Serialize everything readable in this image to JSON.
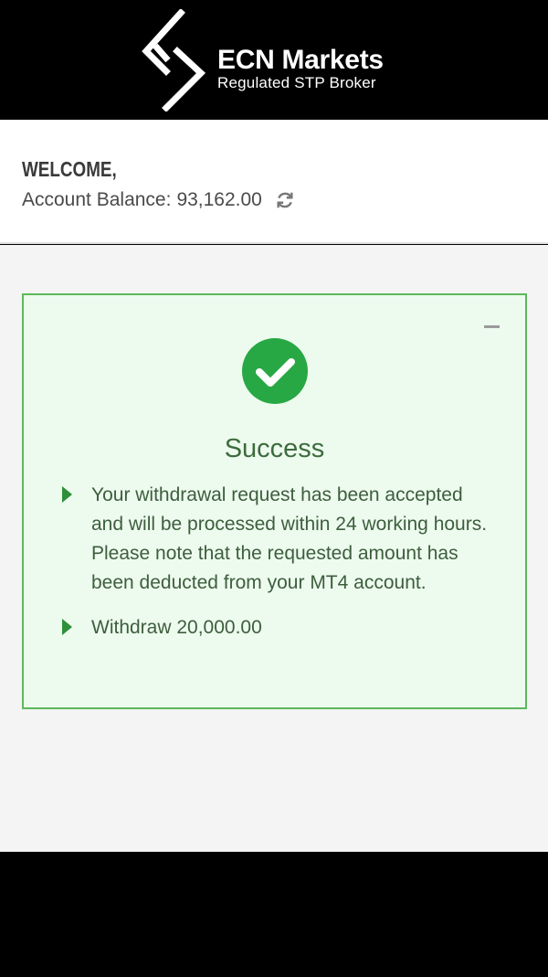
{
  "header": {
    "brand_name": "ECN Markets",
    "tagline": "Regulated STP Broker",
    "logo_icon": "chevron-s-logo-icon"
  },
  "account": {
    "welcome": "WELCOME,",
    "balance_label": "Account Balance:",
    "balance_value": "93,162.00",
    "refresh_icon": "refresh-icon"
  },
  "alert": {
    "status_icon": "check-circle-icon",
    "collapse_icon": "minus-icon",
    "title": "Success",
    "messages": [
      "Your withdrawal request has been accepted and will be processed within 24 working hours. Please note that the requested amount has been deducted from your MT4 account.",
      "Withdraw 20,000.00"
    ]
  },
  "colors": {
    "success_green": "#27a844",
    "box_border": "#5cb85c",
    "box_background": "#edfaee",
    "title_green": "#3d6b3d"
  }
}
